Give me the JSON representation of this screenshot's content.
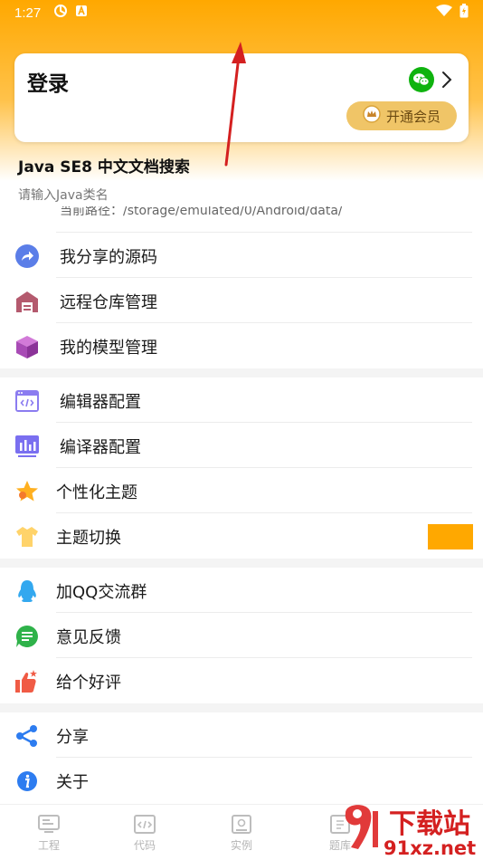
{
  "status_bar": {
    "time": "1:27"
  },
  "login_card": {
    "title": "登录",
    "vip_label": "开通会员"
  },
  "search": {
    "title": "Java SE8 中文文档搜索",
    "placeholder": "请输入Java类名"
  },
  "current_path": "当前路径：/storage/emulated/0/Android/data/",
  "menu_groups": [
    [
      {
        "icon": "share-arrow-icon",
        "label": "我分享的源码"
      },
      {
        "icon": "warehouse-icon",
        "label": "远程仓库管理"
      },
      {
        "icon": "cube-icon",
        "label": "我的模型管理"
      }
    ],
    [
      {
        "icon": "code-window-icon",
        "label": "编辑器配置"
      },
      {
        "icon": "compiler-chart-icon",
        "label": "编译器配置"
      },
      {
        "icon": "star-theme-icon",
        "label": "个性化主题"
      },
      {
        "icon": "tshirt-icon",
        "label": "主题切换"
      }
    ],
    [
      {
        "icon": "qq-penguin-icon",
        "label": "加QQ交流群"
      },
      {
        "icon": "feedback-icon",
        "label": "意见反馈"
      },
      {
        "icon": "thumbs-up-icon",
        "label": "给个好评"
      }
    ],
    [
      {
        "icon": "share-icon",
        "label": "分享"
      },
      {
        "icon": "info-icon",
        "label": "关于"
      }
    ]
  ],
  "theme_color": "#ffa800",
  "bottom_nav": [
    {
      "icon": "project-icon",
      "label": "工程"
    },
    {
      "icon": "code-icon",
      "label": "代码"
    },
    {
      "icon": "example-icon",
      "label": "实例"
    },
    {
      "icon": "questions-icon",
      "label": "题库"
    }
  ],
  "watermark": {
    "brand": "下载站",
    "domain": "91xz.net"
  }
}
